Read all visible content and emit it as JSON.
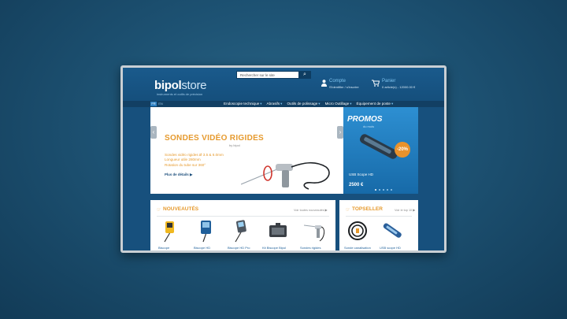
{
  "search": {
    "placeholder": "Rechercher sur le site"
  },
  "brand": {
    "name": "bipol",
    "name_suffix": "store",
    "tagline": "instruments et outils de précision"
  },
  "account": {
    "title": "Compte",
    "subtitle": "S'identifier / s'inscrire"
  },
  "cart": {
    "title": "Panier",
    "subtitle": "0 article(s) - 12000.00 €"
  },
  "languages": [
    "FR",
    "EN"
  ],
  "nav": {
    "items": [
      {
        "label": "Endoscopie technique"
      },
      {
        "label": "Abrasifs"
      },
      {
        "label": "Outils de polissage"
      },
      {
        "label": "Micro Outillage"
      },
      {
        "label": "Équipement de poste"
      }
    ]
  },
  "slide": {
    "title": "SONDES VIDÉO RIGIDES",
    "brand": "by bipol",
    "lines": [
      "Sondes vidéo rigides Ø 3.5 & 6.0mm",
      "Longueur utile 280mm",
      "Rotation du tube sur 360°"
    ],
    "link": "Plus de détails ▶"
  },
  "promo": {
    "title": "PROMOS",
    "subtitle": "du mois",
    "badge": "-20%",
    "product": "USB Scope HD",
    "price": "2500 €"
  },
  "news": {
    "title": "NOUVEAUTÉS",
    "see_all": "Voir toutes nouveautés ▶",
    "products": [
      "Biscope",
      "Biscope HD",
      "Biscope HD Pro",
      "Kit Biscope Bipol",
      "Sondes rigides"
    ]
  },
  "topseller": {
    "title": "TOPSELLER",
    "see_all": "Voir le top 10 ▶",
    "products": [
      "Sonde canalisation",
      "USB scope HD"
    ]
  },
  "colors": {
    "accent": "#e69a2e",
    "nav_bg": "#123f63",
    "header_bg": "#1a5a8c",
    "link": "#1d5f99"
  }
}
